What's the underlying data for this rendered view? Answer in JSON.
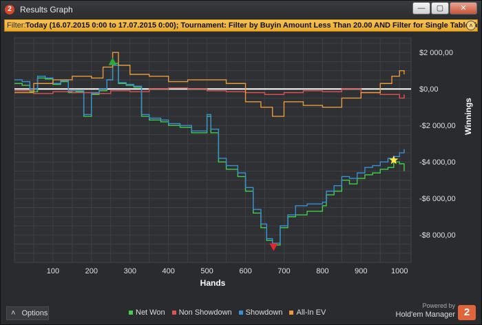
{
  "window": {
    "title": "Results Graph",
    "logo_text": "2",
    "minimize_glyph": "—",
    "maximize_glyph": "▢",
    "close_glyph": "✕"
  },
  "filter": {
    "label": "Filter:",
    "text": "Today (16.07.2015 0:00 to 17.07.2015 0:00); Tournament: Filter by Buyin Amount Less Than 20.00 AND Filter for Single Table Tournaments",
    "toggle_glyph": "˄"
  },
  "chart_data": {
    "type": "line",
    "xlabel": "Hands",
    "ylabel": "Winnings",
    "xlim": [
      0,
      1030
    ],
    "ylim": [
      -9500,
      2800
    ],
    "x_ticks": [
      100,
      200,
      300,
      400,
      500,
      600,
      700,
      800,
      900,
      1000
    ],
    "y_ticks": [
      {
        "value": 2000,
        "label": "$2 000,00"
      },
      {
        "value": 0,
        "label": "$0,00"
      },
      {
        "value": -2000,
        "label": "-$2 000,00"
      },
      {
        "value": -4000,
        "label": "-$4 000,00"
      },
      {
        "value": -6000,
        "label": "-$6 000,00"
      },
      {
        "value": -8000,
        "label": "-$8 000,00"
      }
    ],
    "grid": true,
    "legend_position": "bottom",
    "series": [
      {
        "name": "Net Won",
        "color": "#3fcf4a",
        "points": [
          [
            0,
            300
          ],
          [
            20,
            200
          ],
          [
            40,
            -150
          ],
          [
            60,
            600
          ],
          [
            80,
            550
          ],
          [
            100,
            250
          ],
          [
            120,
            400
          ],
          [
            140,
            -200
          ],
          [
            160,
            -150
          ],
          [
            180,
            -1500
          ],
          [
            200,
            -300
          ],
          [
            220,
            -100
          ],
          [
            240,
            500
          ],
          [
            255,
            1400
          ],
          [
            270,
            300
          ],
          [
            290,
            200
          ],
          [
            310,
            100
          ],
          [
            330,
            -1500
          ],
          [
            350,
            -1700
          ],
          [
            380,
            -1800
          ],
          [
            400,
            -2000
          ],
          [
            430,
            -2100
          ],
          [
            460,
            -2400
          ],
          [
            490,
            -2400
          ],
          [
            500,
            -1500
          ],
          [
            510,
            -2400
          ],
          [
            530,
            -4000
          ],
          [
            550,
            -4400
          ],
          [
            580,
            -4800
          ],
          [
            600,
            -5600
          ],
          [
            620,
            -6800
          ],
          [
            640,
            -7600
          ],
          [
            655,
            -8300
          ],
          [
            670,
            -8550
          ],
          [
            690,
            -7600
          ],
          [
            710,
            -7000
          ],
          [
            730,
            -6900
          ],
          [
            760,
            -6700
          ],
          [
            800,
            -6400
          ],
          [
            810,
            -5800
          ],
          [
            830,
            -5600
          ],
          [
            850,
            -5000
          ],
          [
            870,
            -5200
          ],
          [
            890,
            -4900
          ],
          [
            910,
            -4700
          ],
          [
            930,
            -4600
          ],
          [
            950,
            -4400
          ],
          [
            970,
            -4300
          ],
          [
            985,
            -4000
          ],
          [
            1000,
            -4100
          ],
          [
            1012,
            -4500
          ]
        ]
      },
      {
        "name": "Non Showdown",
        "color": "#e0534f",
        "points": [
          [
            0,
            -100
          ],
          [
            50,
            -250
          ],
          [
            100,
            -150
          ],
          [
            150,
            -200
          ],
          [
            200,
            -250
          ],
          [
            250,
            -100
          ],
          [
            300,
            -150
          ],
          [
            350,
            0
          ],
          [
            400,
            50
          ],
          [
            450,
            0
          ],
          [
            500,
            -100
          ],
          [
            550,
            -150
          ],
          [
            600,
            -200
          ],
          [
            650,
            -300
          ],
          [
            700,
            -200
          ],
          [
            750,
            -100
          ],
          [
            800,
            -150
          ],
          [
            850,
            0
          ],
          [
            900,
            -200
          ],
          [
            950,
            -300
          ],
          [
            1000,
            -500
          ],
          [
            1012,
            -300
          ]
        ]
      },
      {
        "name": "Showdown",
        "color": "#3a8fd6",
        "points": [
          [
            0,
            500
          ],
          [
            20,
            400
          ],
          [
            40,
            0
          ],
          [
            60,
            700
          ],
          [
            80,
            600
          ],
          [
            100,
            300
          ],
          [
            120,
            450
          ],
          [
            140,
            -100
          ],
          [
            160,
            -100
          ],
          [
            180,
            -1400
          ],
          [
            200,
            -200
          ],
          [
            220,
            0
          ],
          [
            240,
            500
          ],
          [
            255,
            1300
          ],
          [
            270,
            350
          ],
          [
            290,
            250
          ],
          [
            310,
            150
          ],
          [
            330,
            -1400
          ],
          [
            350,
            -1600
          ],
          [
            380,
            -1700
          ],
          [
            400,
            -1900
          ],
          [
            430,
            -2000
          ],
          [
            460,
            -2300
          ],
          [
            490,
            -2300
          ],
          [
            500,
            -1400
          ],
          [
            510,
            -2200
          ],
          [
            530,
            -3800
          ],
          [
            550,
            -4200
          ],
          [
            580,
            -4600
          ],
          [
            600,
            -5400
          ],
          [
            620,
            -6600
          ],
          [
            640,
            -7400
          ],
          [
            655,
            -8200
          ],
          [
            670,
            -8450
          ],
          [
            690,
            -7500
          ],
          [
            710,
            -6900
          ],
          [
            730,
            -6400
          ],
          [
            760,
            -6300
          ],
          [
            800,
            -6200
          ],
          [
            810,
            -5600
          ],
          [
            830,
            -5300
          ],
          [
            850,
            -4800
          ],
          [
            870,
            -4900
          ],
          [
            890,
            -4600
          ],
          [
            910,
            -4300
          ],
          [
            930,
            -4200
          ],
          [
            950,
            -4000
          ],
          [
            970,
            -3800
          ],
          [
            985,
            -3700
          ],
          [
            1000,
            -3500
          ],
          [
            1012,
            -3300
          ]
        ]
      },
      {
        "name": "All-In EV",
        "color": "#e89a3c",
        "points": [
          [
            0,
            -200
          ],
          [
            50,
            300
          ],
          [
            100,
            500
          ],
          [
            150,
            700
          ],
          [
            200,
            600
          ],
          [
            230,
            1200
          ],
          [
            255,
            2000
          ],
          [
            270,
            1300
          ],
          [
            300,
            800
          ],
          [
            350,
            700
          ],
          [
            400,
            400
          ],
          [
            450,
            500
          ],
          [
            500,
            500
          ],
          [
            550,
            300
          ],
          [
            600,
            -700
          ],
          [
            640,
            -1000
          ],
          [
            670,
            -1500
          ],
          [
            700,
            -700
          ],
          [
            750,
            -900
          ],
          [
            800,
            -1000
          ],
          [
            850,
            -500
          ],
          [
            900,
            -200
          ],
          [
            950,
            300
          ],
          [
            980,
            700
          ],
          [
            1000,
            1000
          ],
          [
            1012,
            800
          ]
        ]
      }
    ],
    "markers": [
      {
        "type": "max",
        "shape": "triangle-up",
        "color": "#2fa83a",
        "x": 255,
        "y": 1500
      },
      {
        "type": "min",
        "shape": "triangle-down",
        "color": "#e02a2a",
        "x": 673,
        "y": -8650
      },
      {
        "type": "last",
        "shape": "star",
        "color": "#ffe84a",
        "x": 985,
        "y": -3900
      }
    ]
  },
  "bottom": {
    "options_label": "Options",
    "options_glyph": "˄",
    "powered_by": "Powered by",
    "product": "Hold'em Manager",
    "logo_text": "2"
  }
}
